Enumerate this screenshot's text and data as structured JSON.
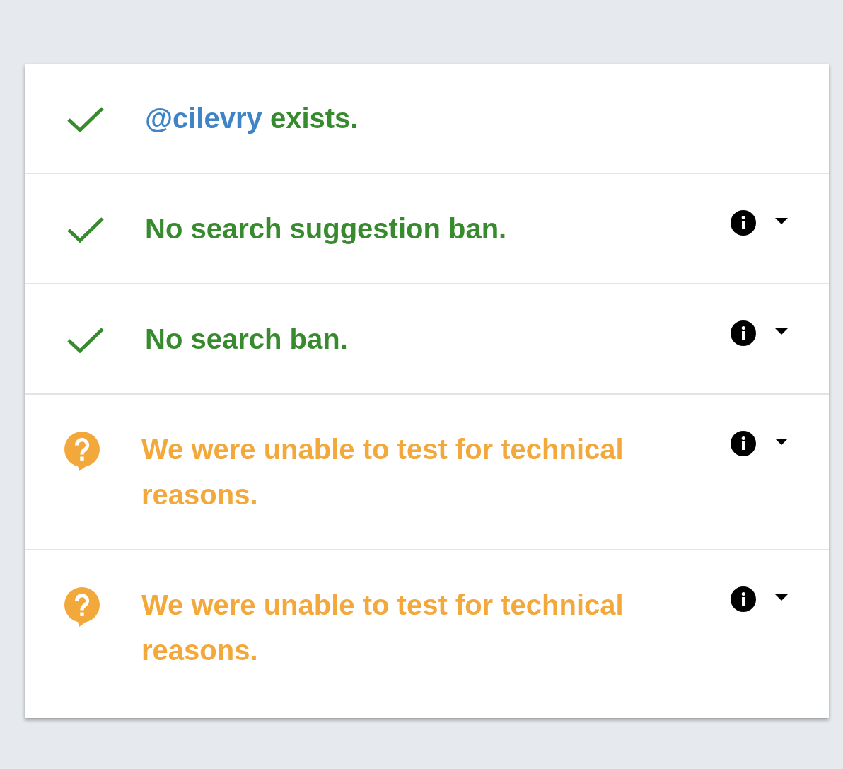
{
  "results": [
    {
      "kind": "passed",
      "handle": "@cilevry",
      "text": "exists.",
      "details": false
    },
    {
      "kind": "passed",
      "text": "No search suggestion ban.",
      "details": true
    },
    {
      "kind": "passed",
      "text": "No search ban.",
      "details": true
    },
    {
      "kind": "unknown",
      "text": "We were unable to test for technical reasons.",
      "details": true
    },
    {
      "kind": "unknown",
      "text": "We were unable to test for technical reasons.",
      "details": true
    }
  ]
}
